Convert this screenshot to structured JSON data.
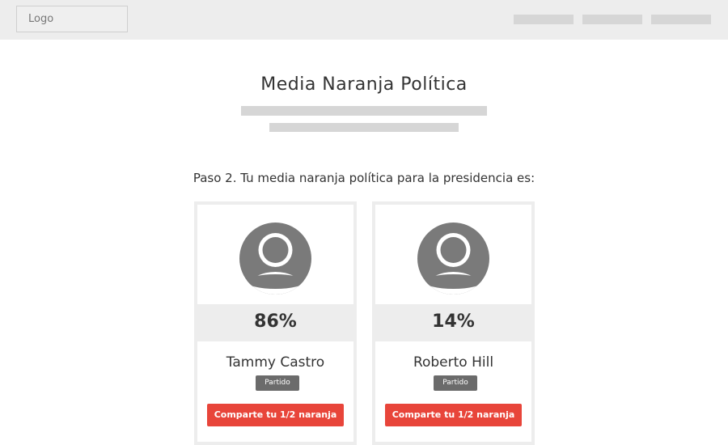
{
  "header": {
    "logo_label": "Logo",
    "nav_items": [
      "",
      "",
      ""
    ]
  },
  "hero": {
    "title": "Media Naranja Política"
  },
  "step": {
    "text": "Paso 2. Tu media naranja política para la presidencia es:"
  },
  "candidates": [
    {
      "percent": "86%",
      "name": "Tammy Castro",
      "party_label": "Partido",
      "share_label": "Comparte tu 1/2 naranja"
    },
    {
      "percent": "14%",
      "name": "Roberto Hill",
      "party_label": "Partido",
      "share_label": "Comparte tu 1/2 naranja"
    }
  ],
  "colors": {
    "accent": "#e8453a",
    "header_bg": "#ededed",
    "placeholder": "#d6d6d6",
    "avatar": "#7a7a7a"
  },
  "icons": {
    "avatar": "user-avatar-icon"
  }
}
